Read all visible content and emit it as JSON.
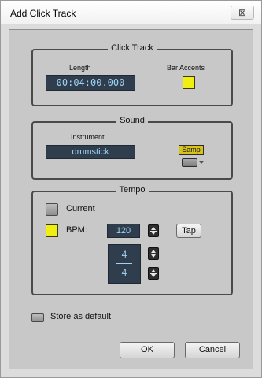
{
  "window": {
    "title": "Add Click Track",
    "close_glyph": "⊠"
  },
  "click_track": {
    "group_title": "Click Track",
    "length_label": "Length",
    "length_value": "00:04:00.000",
    "bar_accents_label": "Bar Accents"
  },
  "sound": {
    "group_title": "Sound",
    "instrument_label": "Instrument",
    "instrument_value": "drumstick",
    "samp_label": "Samp"
  },
  "tempo": {
    "group_title": "Tempo",
    "current_label": "Current",
    "bpm_label": "BPM:",
    "bpm_value": "120",
    "tap_label": "Tap",
    "time_sig_top": "4",
    "time_sig_bottom": "4"
  },
  "footer": {
    "store_default_label": "Store as default",
    "ok_label": "OK",
    "cancel_label": "Cancel"
  },
  "colors": {
    "accent_yellow": "#f1ee12",
    "lcd_bg": "#2f3d4c",
    "lcd_text": "#9fd3f5"
  }
}
